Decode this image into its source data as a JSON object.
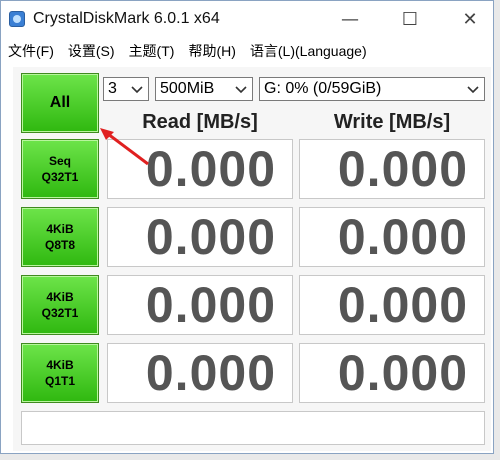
{
  "window": {
    "title": "CrystalDiskMark 6.0.1 x64",
    "minimize": "—",
    "maximize": "☐",
    "close": "✕"
  },
  "menu": [
    {
      "label": "文件(F)"
    },
    {
      "label": "设置(S)"
    },
    {
      "label": "主题(T)"
    },
    {
      "label": "帮助(H)"
    },
    {
      "label": "语言(L)(Language)"
    }
  ],
  "controls": {
    "all_label": "All",
    "count": "3",
    "size": "500MiB",
    "drive": "G: 0% (0/59GiB)"
  },
  "headers": {
    "read": "Read [MB/s]",
    "write": "Write [MB/s]"
  },
  "tests": [
    {
      "label": "Seq\nQ32T1",
      "read": "0.000",
      "write": "0.000"
    },
    {
      "label": "4KiB\nQ8T8",
      "read": "0.000",
      "write": "0.000"
    },
    {
      "label": "4KiB\nQ32T1",
      "read": "0.000",
      "write": "0.000"
    },
    {
      "label": "4KiB\nQ1T1",
      "read": "0.000",
      "write": "0.000"
    }
  ],
  "status": "",
  "colors": {
    "button_green": "#3cc81a",
    "annotation_arrow": "#e02020"
  }
}
